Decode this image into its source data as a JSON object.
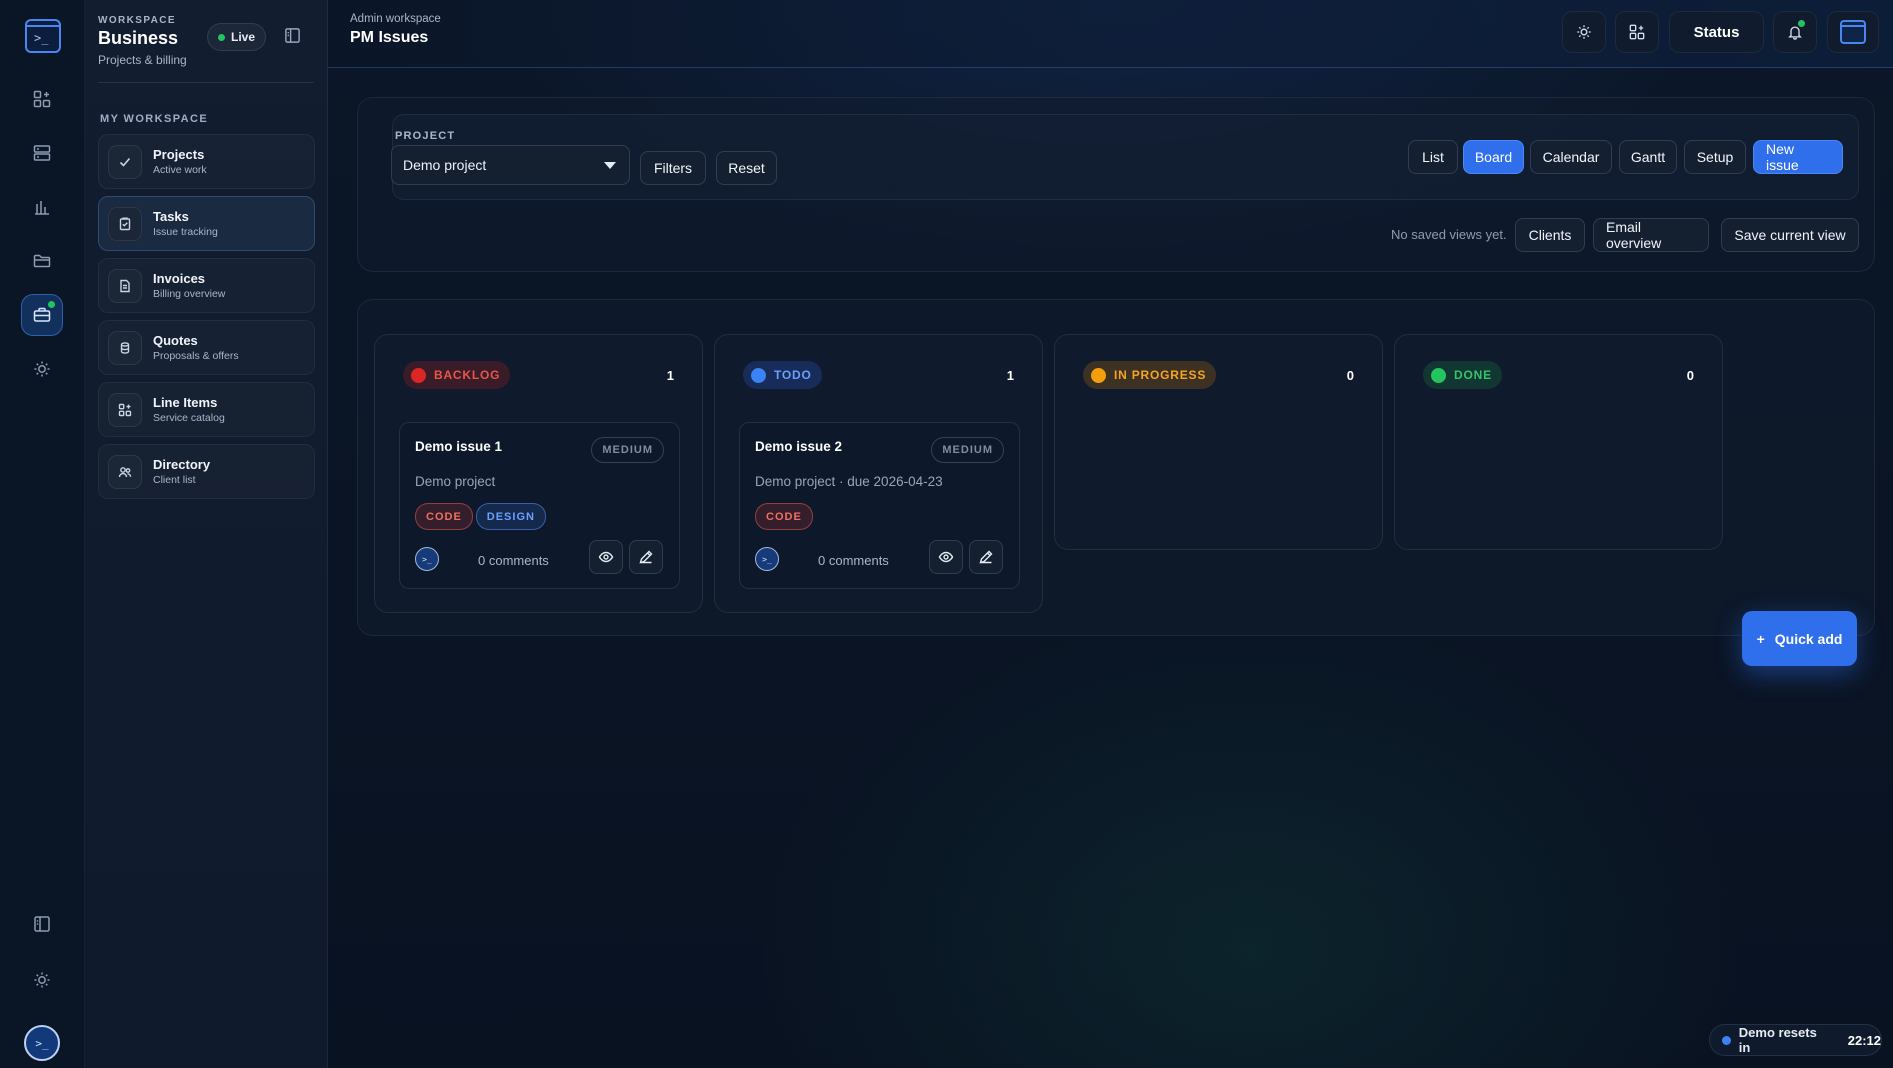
{
  "rail": {
    "logo_glyph": ">_",
    "avatar_glyph": ">_",
    "icons": [
      "apps-icon",
      "server-icon",
      "chart-icon",
      "folder-icon",
      "briefcase-icon",
      "sun-icon"
    ],
    "bottom_icons": [
      "panel-toggle-icon",
      "sun-icon"
    ]
  },
  "sidebar": {
    "kicker": "WORKSPACE",
    "name": "Business",
    "subtitle": "Projects & billing",
    "live_label": "Live",
    "section_label": "MY WORKSPACE",
    "items": [
      {
        "title": "Projects",
        "subtitle": "Active work",
        "icon": "check-icon"
      },
      {
        "title": "Tasks",
        "subtitle": "Issue tracking",
        "icon": "clipboard-icon",
        "active": true
      },
      {
        "title": "Invoices",
        "subtitle": "Billing overview",
        "icon": "document-icon"
      },
      {
        "title": "Quotes",
        "subtitle": "Proposals & offers",
        "icon": "stack-icon"
      },
      {
        "title": "Line Items",
        "subtitle": "Service catalog",
        "icon": "grid-icon"
      },
      {
        "title": "Directory",
        "subtitle": "Client list",
        "icon": "users-icon"
      }
    ]
  },
  "header": {
    "kicker": "Admin workspace",
    "title": "PM Issues",
    "status_label": "Status"
  },
  "toolbar": {
    "project_label": "PROJECT",
    "project_value": "Demo project",
    "filters_label": "Filters",
    "reset_label": "Reset",
    "views": [
      "List",
      "Board",
      "Calendar",
      "Gantt",
      "Setup"
    ],
    "active_view": "Board",
    "new_issue_label": "New issue",
    "saved_views_note": "No saved views yet.",
    "clients_label": "Clients",
    "email_overview_label": "Email overview",
    "save_view_label": "Save current view"
  },
  "board": {
    "columns": [
      {
        "label": "BACKLOG",
        "count": "1",
        "color": "#dc2626",
        "text_color": "#e8564a",
        "bg": "rgba(160,30,30,0.30)"
      },
      {
        "label": "TODO",
        "count": "1",
        "color": "#3b82f6",
        "text_color": "#6aa0ff",
        "bg": "rgba(40,80,170,0.35)"
      },
      {
        "label": "IN PROGRESS",
        "count": "0",
        "color": "#f59e0b",
        "text_color": "#f5a524",
        "bg": "rgba(150,95,20,0.35)"
      },
      {
        "label": "DONE",
        "count": "0",
        "color": "#22c55e",
        "text_color": "#34c46a",
        "bg": "rgba(25,110,60,0.35)"
      }
    ],
    "cards": [
      {
        "title": "Demo issue 1",
        "priority": "MEDIUM",
        "meta": "Demo project",
        "tags": [
          "CODE",
          "DESIGN"
        ],
        "comments": "0 comments"
      },
      {
        "title": "Demo issue 2",
        "priority": "MEDIUM",
        "meta": "Demo project · due 2026-04-23",
        "tags": [
          "CODE"
        ],
        "comments": "0 comments"
      }
    ]
  },
  "quick_add_label": "Quick add",
  "quick_add_glyph": "+",
  "demo": {
    "label": "Demo resets in",
    "time": "22:12"
  },
  "colors": {
    "accent": "#2f6fec",
    "live": "#22c55e"
  }
}
